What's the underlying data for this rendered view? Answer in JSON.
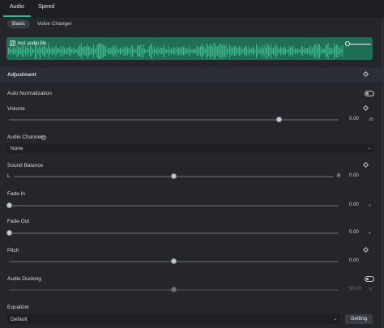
{
  "tabs": [
    {
      "label": "Audio",
      "active": true
    },
    {
      "label": "Speed",
      "active": false
    }
  ],
  "subtabs": [
    {
      "label": "Basic",
      "active": true
    },
    {
      "label": "Voice Changer",
      "active": false
    }
  ],
  "waveform": {
    "file_name": "test audio file",
    "color": "#1f6f57"
  },
  "section": {
    "title": "Adjustment"
  },
  "auto_normalization": {
    "label": "Auto Normalization",
    "enabled": false
  },
  "volume": {
    "label": "Volume",
    "value": "0.00",
    "unit": "dB",
    "level": 0.82
  },
  "audio_channels": {
    "label": "Audio Channels",
    "value": "None"
  },
  "sound_balance": {
    "label": "Sound Balance",
    "left": "L",
    "right": "R",
    "value": "0.00",
    "level": 0.5
  },
  "fade_in": {
    "label": "Fade In",
    "value": "0.00",
    "unit": "s",
    "level": 0.0
  },
  "fade_out": {
    "label": "Fade Out",
    "value": "0.00",
    "unit": "s",
    "level": 0.0
  },
  "pitch": {
    "label": "Pitch",
    "value": "0.00",
    "level": 0.5
  },
  "audio_ducking": {
    "label": "Audio Ducking",
    "enabled": false,
    "value": "50.00",
    "unit": "%",
    "level": 0.5
  },
  "equalizer": {
    "label": "Equalizer",
    "value": "Default",
    "setting_label": "Setting"
  },
  "colors": {
    "accent": "#2ebfa5",
    "background": "#24262b"
  }
}
